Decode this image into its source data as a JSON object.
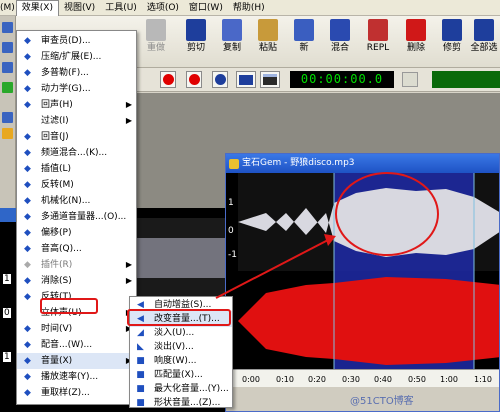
{
  "menubar": {
    "items": [
      {
        "label": "(M)",
        "active": false
      },
      {
        "label": "效果(X)",
        "active": true
      },
      {
        "label": "视图(V)",
        "active": false
      },
      {
        "label": "工具(U)",
        "active": false
      },
      {
        "label": "选项(O)",
        "active": false
      },
      {
        "label": "窗口(W)",
        "active": false
      },
      {
        "label": "帮助(H)",
        "active": false
      }
    ]
  },
  "toolbar": {
    "buttons": [
      {
        "label": "重做",
        "icon": "redo-icon",
        "color": "#9a9a9a",
        "disabled": true
      },
      {
        "label": "剪切",
        "icon": "scissors-icon",
        "color": "#1e3e9c"
      },
      {
        "label": "复制",
        "icon": "copy-icon",
        "color": "#4a68c8"
      },
      {
        "label": "粘贴",
        "icon": "paste-icon",
        "color": "#c89a3a"
      },
      {
        "label": "新",
        "icon": "new-file-icon",
        "color": "#3a5ec0"
      },
      {
        "label": "混合",
        "icon": "mix-icon",
        "color": "#2a4ab0"
      },
      {
        "label": "REPL",
        "icon": "replace-icon",
        "color": "#c03030"
      },
      {
        "label": "删除",
        "icon": "delete-icon",
        "color": "#d01818"
      },
      {
        "label": "修剪",
        "icon": "trim-icon",
        "color": "#1e3e9c"
      },
      {
        "label": "全部选",
        "icon": "select-all-icon",
        "color": "#1e3e9c"
      }
    ]
  },
  "time_display": "00:00:00.0",
  "effects_menu": {
    "items": [
      {
        "label": "审查员(D)...",
        "icon": "censor-icon",
        "submenu": false,
        "dim": false
      },
      {
        "label": "压缩/扩展(E)...",
        "icon": "compress-icon",
        "submenu": false,
        "dim": false
      },
      {
        "label": "多普勒(F)...",
        "icon": "doppler-icon",
        "submenu": false,
        "dim": false
      },
      {
        "label": "动力学(G)...",
        "icon": "dynamics-icon",
        "submenu": false,
        "dim": false
      },
      {
        "label": "回声(H)",
        "icon": "echo-icon",
        "submenu": true,
        "dim": false
      },
      {
        "label": "过滤(I)",
        "icon": "filter-icon",
        "submenu": true,
        "dim": false
      },
      {
        "label": "回音(J)",
        "icon": "reverb-icon",
        "submenu": false,
        "dim": false
      },
      {
        "label": "频道混合...(K)...",
        "icon": "channel-mix-icon",
        "submenu": false,
        "dim": false
      },
      {
        "label": "插值(L)",
        "icon": "interpolate-icon",
        "submenu": false,
        "dim": false
      },
      {
        "label": "反转(M)",
        "icon": "invert-icon",
        "submenu": false,
        "dim": false
      },
      {
        "label": "机械化(N)...",
        "icon": "mechanize-icon",
        "submenu": false,
        "dim": false
      },
      {
        "label": "多通道音量器...(O)...",
        "icon": "multichannel-icon",
        "submenu": false,
        "dim": false
      },
      {
        "label": "偏移(P)",
        "icon": "offset-icon",
        "submenu": false,
        "dim": false
      },
      {
        "label": "音高(Q)...",
        "icon": "pitch-icon",
        "submenu": false,
        "dim": false
      },
      {
        "label": "插件(R)",
        "icon": "plugin-icon",
        "submenu": true,
        "dim": true
      },
      {
        "label": "消除(S)",
        "icon": "remove-icon",
        "submenu": true,
        "dim": false
      },
      {
        "label": "反转(T)",
        "icon": "reverse-icon",
        "submenu": false,
        "dim": false
      },
      {
        "label": "立体声(U)",
        "icon": "stereo-icon",
        "submenu": true,
        "dim": false
      },
      {
        "label": "时间(V)",
        "icon": "time-icon",
        "submenu": true,
        "dim": false
      },
      {
        "label": "配音...(W)...",
        "icon": "dub-icon",
        "submenu": false,
        "dim": false
      },
      {
        "label": "音量(X)",
        "icon": "volume-icon",
        "submenu": true,
        "dim": false
      },
      {
        "label": "播放速率(Y)...",
        "icon": "playback-rate-icon",
        "submenu": false,
        "dim": false
      },
      {
        "label": "重取样(Z)...",
        "icon": "resample-icon",
        "submenu": false,
        "dim": false
      }
    ]
  },
  "volume_submenu": {
    "items": [
      {
        "label": "自动增益(S)...",
        "icon": "auto-gain-icon"
      },
      {
        "label": "改变音量...(T)...",
        "icon": "change-volume-icon"
      },
      {
        "label": "淡入(U)...",
        "icon": "fade-in-icon"
      },
      {
        "label": "淡出(V)...",
        "icon": "fade-out-icon"
      },
      {
        "label": "响度(W)...",
        "icon": "loudness-icon"
      },
      {
        "label": "匹配量(X)...",
        "icon": "match-volume-icon"
      },
      {
        "label": "最大化音量...(Y)...",
        "icon": "maximize-volume-icon"
      },
      {
        "label": "形状音量...(Z)...",
        "icon": "shape-volume-icon"
      }
    ]
  },
  "front_window": {
    "title": "宝石Gem - 野狼disco.mp3",
    "channel_labels": [
      "1",
      "0",
      "-1"
    ],
    "ruler_ticks": [
      "0:00",
      "0:10",
      "0:20",
      "0:30",
      "0:40",
      "0:50",
      "1:00",
      "1:10"
    ]
  },
  "back_window": {
    "labels": [
      "1",
      "0",
      "1"
    ]
  },
  "watermark": "@51CTO博客",
  "colors": {
    "waveform_top": "#d8d8e0",
    "waveform_bottom": "#e01010",
    "selection": "#1e2aa8",
    "annotation": "#e01818"
  }
}
